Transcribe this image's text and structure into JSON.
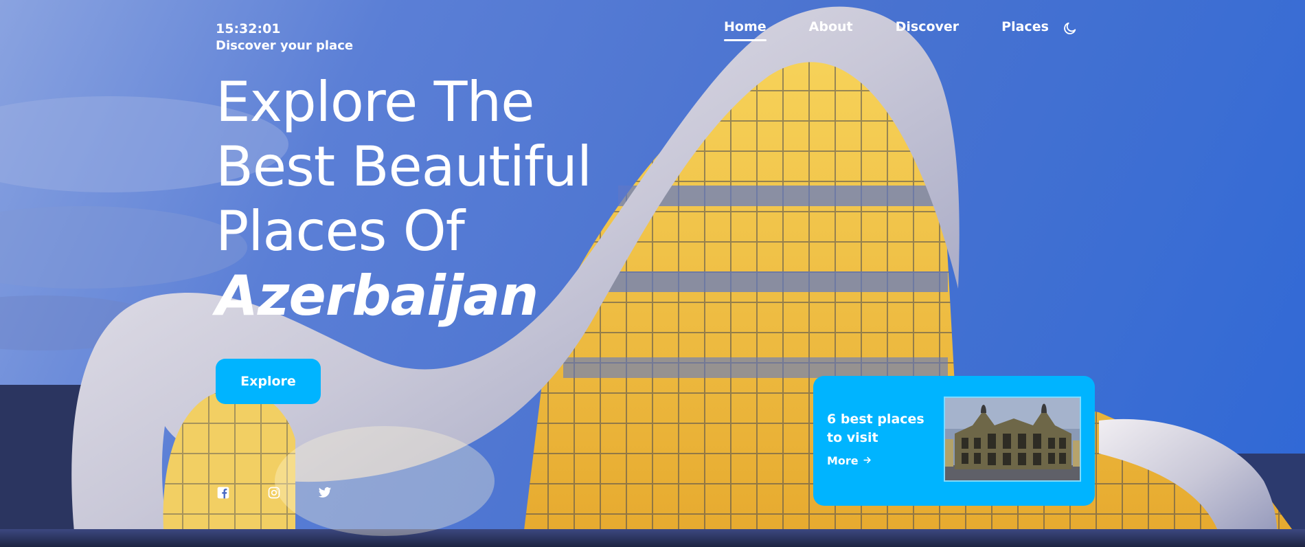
{
  "header": {
    "time": "15:32:01",
    "tagline": "Discover your place"
  },
  "nav": {
    "items": [
      {
        "label": "Home",
        "active": true
      },
      {
        "label": "About",
        "active": false
      },
      {
        "label": "Discover",
        "active": false
      },
      {
        "label": "Places",
        "active": false
      }
    ],
    "theme_icon": "moon-icon"
  },
  "hero": {
    "title_line1": "Explore The",
    "title_line2": "Best Beautiful",
    "title_line3": "Places Of",
    "title_country": "Azerbaijan",
    "cta_label": "Explore"
  },
  "social": [
    {
      "name": "facebook-icon"
    },
    {
      "name": "instagram-icon"
    },
    {
      "name": "twitter-icon"
    }
  ],
  "promo": {
    "title": "6 best places to visit",
    "link_label": "More",
    "link_icon": "arrow-right-icon"
  },
  "colors": {
    "accent": "#00b4ff",
    "sky": "#4a73d0"
  }
}
